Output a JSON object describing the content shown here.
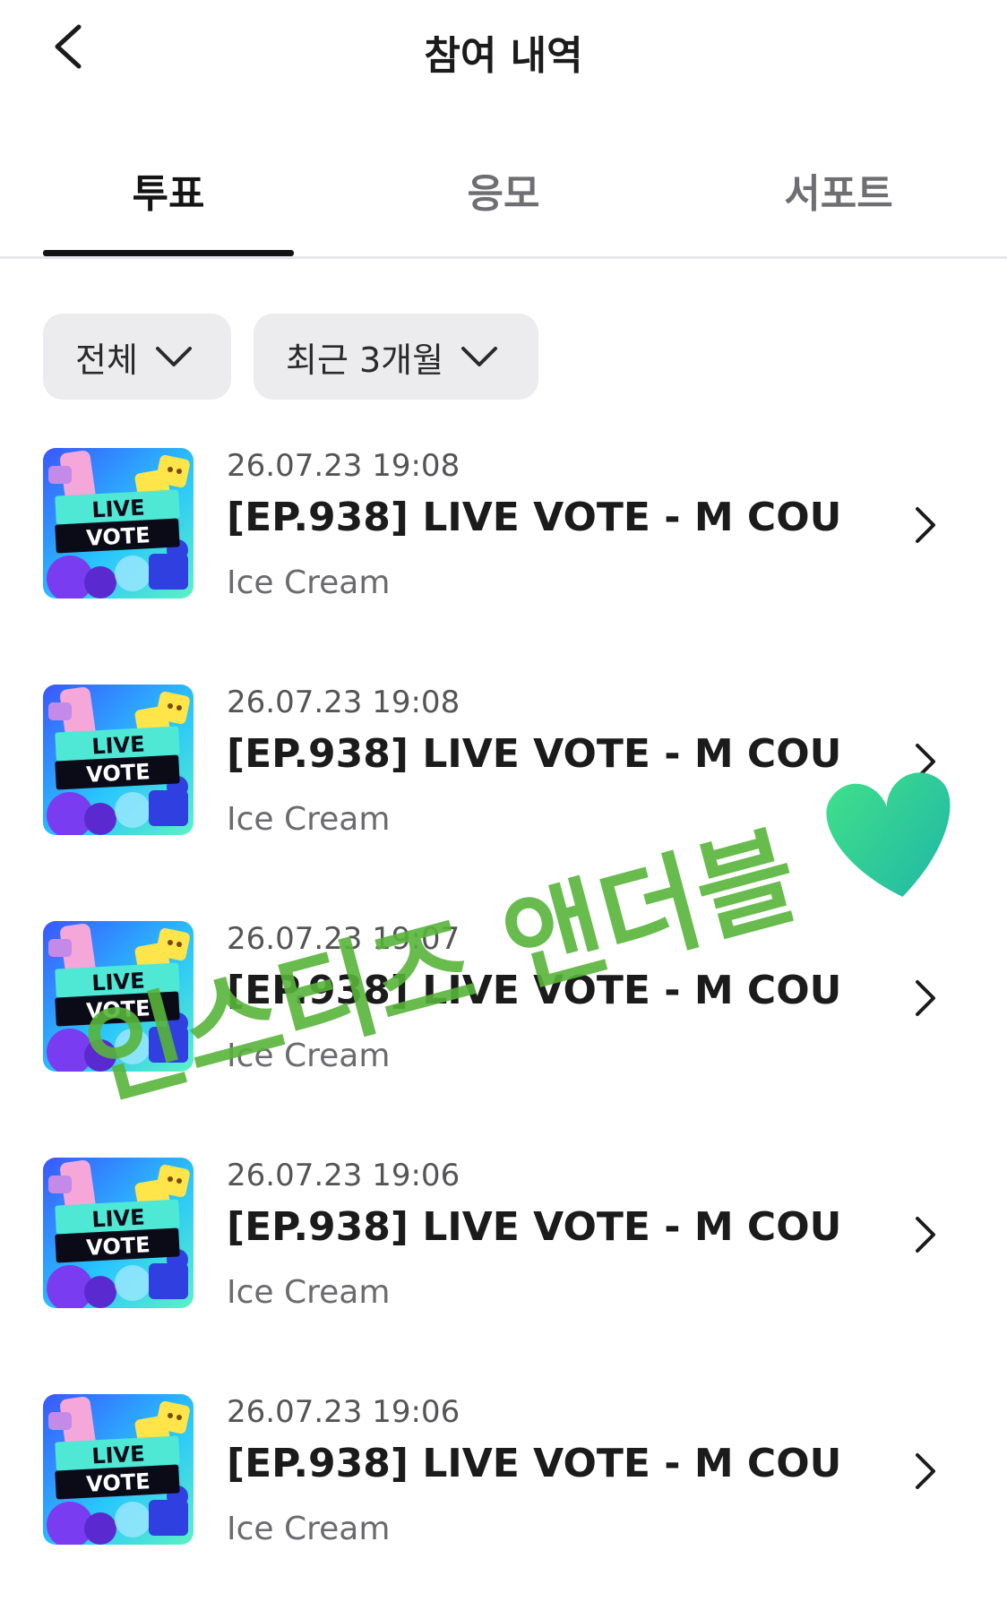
{
  "header": {
    "title": "참여 내역"
  },
  "tabs": [
    {
      "label": "투표",
      "active": true
    },
    {
      "label": "응모",
      "active": false
    },
    {
      "label": "서포트",
      "active": false
    }
  ],
  "filters": [
    {
      "label": "전체"
    },
    {
      "label": "최근 3개월"
    }
  ],
  "thumbnail": {
    "line1": "LIVE",
    "line2": "VOTE"
  },
  "items": [
    {
      "date": "26.07.23 19:08",
      "title": "[EP.938] LIVE VOTE - M COU...",
      "artist": "Ice Cream"
    },
    {
      "date": "26.07.23 19:08",
      "title": "[EP.938] LIVE VOTE - M COU...",
      "artist": "Ice Cream"
    },
    {
      "date": "26.07.23 19:07",
      "title": "[EP.938] LIVE VOTE - M COU...",
      "artist": "Ice Cream"
    },
    {
      "date": "26.07.23 19:06",
      "title": "[EP.938] LIVE VOTE - M COU...",
      "artist": "Ice Cream"
    },
    {
      "date": "26.07.23 19:06",
      "title": "[EP.938] LIVE VOTE - M COU...",
      "artist": "Ice Cream"
    }
  ],
  "watermark": {
    "text": "인스티즈 앤더블",
    "color": "#58b43a",
    "heart_color": "#2fd08a"
  },
  "icons": {
    "back": "chevron-left-icon",
    "dropdown": "chevron-down-icon",
    "row_arrow": "chevron-right-icon",
    "heart": "green-heart-icon"
  }
}
